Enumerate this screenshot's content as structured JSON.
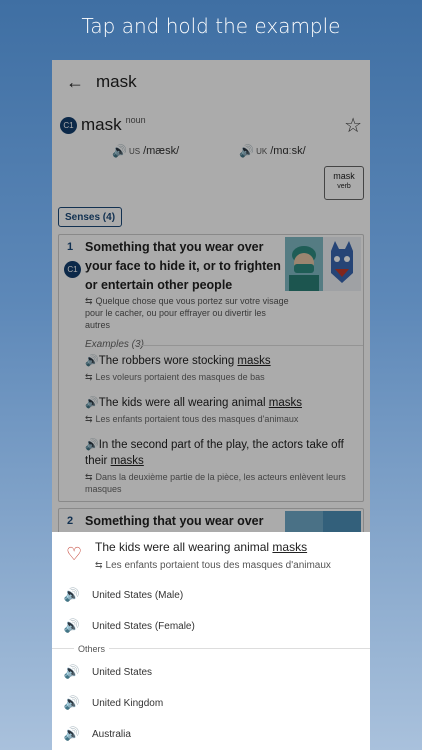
{
  "caption": "Tap and hold the example",
  "appbar": {
    "title": "mask",
    "back_icon": "arrow-left-icon"
  },
  "entry": {
    "level": "C1",
    "headword": "mask",
    "pos": "noun",
    "pron_us_label": "US",
    "pron_us_ipa": "/mæsk/",
    "pron_uk_label": "UK",
    "pron_uk_ipa": "/mɑːsk/",
    "related_word": "mask",
    "related_pos": "verb",
    "senses_tab": "Senses (4)",
    "colors": {
      "us": "#3b6aa0",
      "uk": "#c0392b",
      "brand": "#1c4a7a"
    }
  },
  "senses": [
    {
      "num": "1",
      "level": "C1",
      "definition": "Something that you wear over your face to hide it, or to frighten or entertain other people",
      "translation": "Quelque chose que vous portez sur votre visage pour le cacher, ou pour effrayer ou divertir les autres",
      "examples_label": "Examples (3)",
      "examples": [
        {
          "pre": "The robbers wore stocking ",
          "word": "masks",
          "post": "",
          "tr": "Les voleurs portaient des masques de bas"
        },
        {
          "pre": "The kids were all wearing animal ",
          "word": "masks",
          "post": "",
          "tr": "Les enfants portaient tous des masques d'animaux"
        },
        {
          "pre": "In the second part of the play, the actors take off their ",
          "word": "masks",
          "post": "",
          "tr": "Dans la deuxième partie de la pièce, les acteurs enlèvent leurs masques"
        }
      ]
    },
    {
      "num": "2",
      "definition": "Something that you wear over"
    }
  ],
  "sheet": {
    "example_pre": "The kids were all wearing animal ",
    "example_word": "masks",
    "example_tr": "Les enfants portaient tous des masques d'animaux",
    "options": [
      {
        "label": "United States (Male)",
        "color": "#3b6aa0"
      },
      {
        "label": "United States (Female)",
        "color": "#c0392b"
      }
    ],
    "others_label": "Others",
    "others": [
      {
        "label": "United States"
      },
      {
        "label": "United Kingdom"
      },
      {
        "label": "Australia"
      }
    ]
  }
}
